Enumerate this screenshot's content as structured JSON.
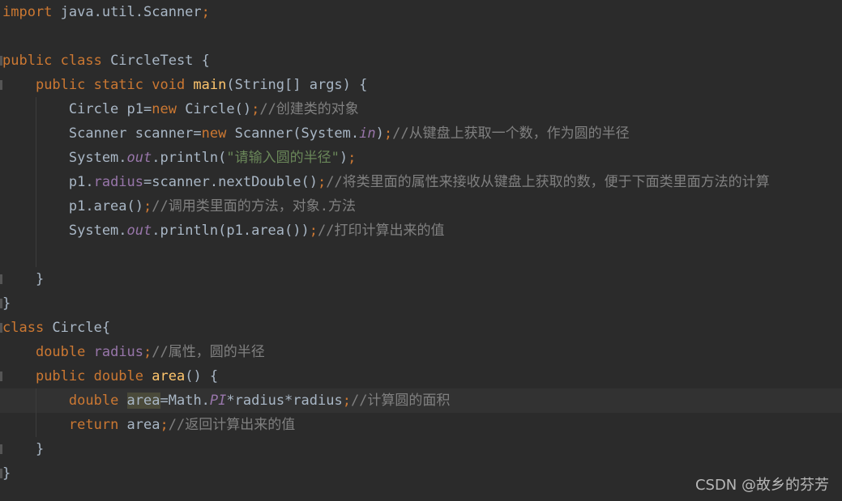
{
  "code_lines": [
    [
      [
        "kw",
        "import"
      ],
      [
        "pl",
        " java.util.Scanner"
      ],
      [
        "kw",
        ";"
      ]
    ],
    [],
    [
      [
        "kw",
        "public class "
      ],
      [
        "pl",
        "CircleTest {"
      ]
    ],
    [
      [
        "pl",
        "    "
      ],
      [
        "kw",
        "public static void "
      ],
      [
        "fn",
        "main"
      ],
      [
        "pl",
        "(String[] args) {"
      ]
    ],
    [
      [
        "pl",
        "        Circle p1="
      ],
      [
        "kw",
        "new "
      ],
      [
        "pl",
        "Circle()"
      ],
      [
        "kw",
        ";"
      ],
      [
        "cm",
        "//创建类的对象"
      ]
    ],
    [
      [
        "pl",
        "        Scanner scanner="
      ],
      [
        "kw",
        "new "
      ],
      [
        "pl",
        "Scanner(System."
      ],
      [
        "st",
        "in"
      ],
      [
        "pl",
        ")"
      ],
      [
        "kw",
        ";"
      ],
      [
        "cm",
        "//从键盘上获取一个数，作为圆的半径"
      ]
    ],
    [
      [
        "pl",
        "        System."
      ],
      [
        "st",
        "out"
      ],
      [
        "pl",
        ".println("
      ],
      [
        "sr",
        "\"请输入圆的半径\""
      ],
      [
        "pl",
        ")"
      ],
      [
        "kw",
        ";"
      ]
    ],
    [
      [
        "pl",
        "        p1."
      ],
      [
        "fd",
        "radius"
      ],
      [
        "pl",
        "=scanner.nextDouble()"
      ],
      [
        "kw",
        ";"
      ],
      [
        "cm",
        "//将类里面的属性来接收从键盘上获取的数，便于下面类里面方法的计算"
      ]
    ],
    [
      [
        "pl",
        "        p1.area()"
      ],
      [
        "kw",
        ";"
      ],
      [
        "cm",
        "//调用类里面的方法，对象.方法"
      ]
    ],
    [
      [
        "pl",
        "        System."
      ],
      [
        "st",
        "out"
      ],
      [
        "pl",
        ".println(p1.area())"
      ],
      [
        "kw",
        ";"
      ],
      [
        "cm",
        "//打印计算出来的值"
      ]
    ],
    [],
    [
      [
        "pl",
        "    }"
      ]
    ],
    [
      [
        "pl",
        "}"
      ]
    ],
    [
      [
        "kw",
        "class "
      ],
      [
        "pl",
        "Circle{"
      ]
    ],
    [
      [
        "pl",
        "    "
      ],
      [
        "kw",
        "double "
      ],
      [
        "fd",
        "radius"
      ],
      [
        "kw",
        ";"
      ],
      [
        "cm",
        "//属性，圆的半径"
      ]
    ],
    [
      [
        "pl",
        "    "
      ],
      [
        "kw",
        "public double "
      ],
      [
        "fn",
        "area"
      ],
      [
        "pl",
        "() {"
      ]
    ],
    [
      [
        "pl",
        "        "
      ],
      [
        "kw",
        "double "
      ],
      [
        "hl",
        "area"
      ],
      [
        "pl",
        "=Math."
      ],
      [
        "st",
        "PI"
      ],
      [
        "pl",
        "*radius*radius"
      ],
      [
        "kw",
        ";"
      ],
      [
        "cm",
        "//计算圆的面积"
      ]
    ],
    [
      [
        "pl",
        "        "
      ],
      [
        "kw",
        "return "
      ],
      [
        "pl",
        "area"
      ],
      [
        "kw",
        ";"
      ],
      [
        "cm",
        "//返回计算出来的值"
      ]
    ],
    [
      [
        "pl",
        "    }"
      ]
    ],
    [
      [
        "pl",
        "}"
      ]
    ]
  ],
  "current_line": 17,
  "watermark": "CSDN @故乡的芬芳"
}
